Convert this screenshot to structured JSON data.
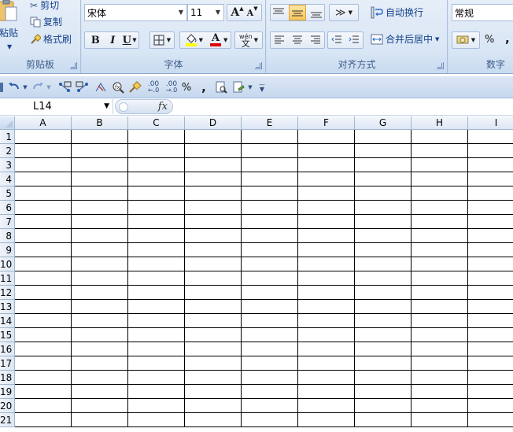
{
  "ribbon": {
    "clipboard": {
      "paste_label": "粘贴",
      "cut_label": "剪切",
      "copy_label": "复制",
      "format_painter_label": "格式刷",
      "group_label": "剪贴板"
    },
    "font": {
      "font_name": "宋体",
      "font_size": "11",
      "grow_label": "A",
      "shrink_label": "A",
      "bold": "B",
      "italic": "I",
      "underline": "U",
      "font_color_label": "A",
      "phonetic_label": "wén",
      "phonetic_glyph": "文",
      "group_label": "字体"
    },
    "alignment": {
      "wrap_text_label": "自动换行",
      "merge_center_label": "合并后居中",
      "group_label": "对齐方式"
    },
    "number": {
      "format_value": "常规",
      "percent_label": "%",
      "comma_label": ",",
      "group_label": "数字"
    }
  },
  "qat": {
    "percent": "%",
    "comma": ",",
    "inc_decimal": ".00",
    "dec_decimal": ".00"
  },
  "formula_bar": {
    "name_box": "L14",
    "fx_label": "fx"
  },
  "sheet": {
    "columns": [
      "A",
      "B",
      "C",
      "D",
      "E",
      "F",
      "G",
      "H",
      "I"
    ],
    "rows": [
      "1",
      "2",
      "3",
      "4",
      "5",
      "6",
      "7",
      "8",
      "9",
      "10",
      "11",
      "12",
      "13",
      "14",
      "15",
      "16",
      "17",
      "18",
      "19",
      "20",
      "21"
    ]
  },
  "colors": {
    "ribbon_bg": "#d3e1f1",
    "header_bg": "#dce6f4",
    "font_color_bar": "#e00000",
    "fill_color_bar": "#ffff00"
  }
}
